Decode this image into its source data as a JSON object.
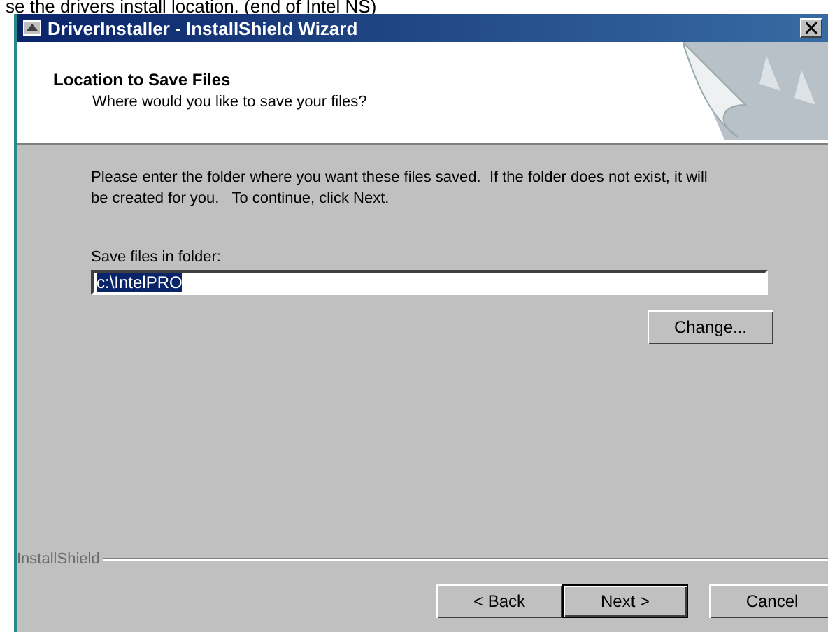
{
  "caption": "se the drivers install location. (end of Intel NS)",
  "window": {
    "title": "DriverInstaller - InstallShield Wizard"
  },
  "header": {
    "title": "Location to Save Files",
    "subtitle": "Where would you like to save your files?"
  },
  "body": {
    "instructions": "Please enter the folder where you want these files saved.  If the folder does not exist, it will be created for you.   To continue, click Next.",
    "folder_label": "Save files in folder:",
    "folder_value": "c:\\IntelPRO",
    "folder_value_selected": true,
    "change_button": "Change..."
  },
  "brand": "InstallShield",
  "buttons": [
    {
      "label": "< Back",
      "default": false
    },
    {
      "label": "Next >",
      "default": true
    },
    {
      "label": "Cancel",
      "default": false
    }
  ]
}
